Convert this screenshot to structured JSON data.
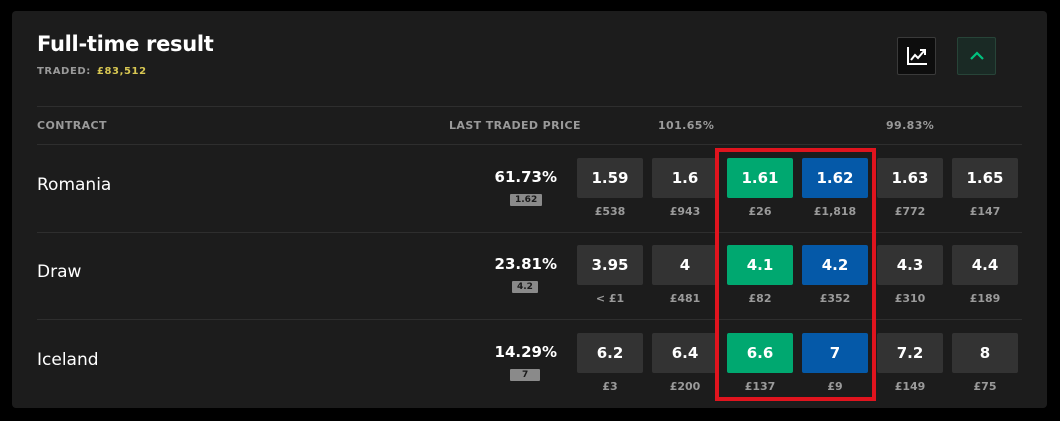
{
  "market": {
    "title": "Full-time result",
    "traded_label": "TRADED:",
    "traded_amount": "£83,512"
  },
  "header": {
    "contract": "CONTRACT",
    "last_traded_price": "LAST TRADED PRICE",
    "back_overround": "101.65%",
    "lay_overround": "99.83%"
  },
  "icons": {
    "chart": "line-chart-icon",
    "collapse": "chevron-up-icon"
  },
  "colors": {
    "back": "#00a870",
    "lay": "#0559a8",
    "highlight": "#e0141e",
    "traded_amount": "#d8c752"
  },
  "rows": [
    {
      "name": "Romania",
      "probability": "61.73%",
      "ltp": "1.62",
      "prices": [
        {
          "odds": "1.59",
          "vol": "£538"
        },
        {
          "odds": "1.6",
          "vol": "£943"
        },
        {
          "odds": "1.61",
          "vol": "£26"
        },
        {
          "odds": "1.62",
          "vol": "£1,818"
        },
        {
          "odds": "1.63",
          "vol": "£772"
        },
        {
          "odds": "1.65",
          "vol": "£147"
        }
      ]
    },
    {
      "name": "Draw",
      "probability": "23.81%",
      "ltp": "4.2",
      "prices": [
        {
          "odds": "3.95",
          "vol": "< £1"
        },
        {
          "odds": "4",
          "vol": "£481"
        },
        {
          "odds": "4.1",
          "vol": "£82"
        },
        {
          "odds": "4.2",
          "vol": "£352"
        },
        {
          "odds": "4.3",
          "vol": "£310"
        },
        {
          "odds": "4.4",
          "vol": "£189"
        }
      ]
    },
    {
      "name": "Iceland",
      "probability": "14.29%",
      "ltp": "7",
      "prices": [
        {
          "odds": "6.2",
          "vol": "£3"
        },
        {
          "odds": "6.4",
          "vol": "£200"
        },
        {
          "odds": "6.6",
          "vol": "£137"
        },
        {
          "odds": "7",
          "vol": "£9"
        },
        {
          "odds": "7.2",
          "vol": "£149"
        },
        {
          "odds": "8",
          "vol": "£75"
        }
      ]
    }
  ]
}
